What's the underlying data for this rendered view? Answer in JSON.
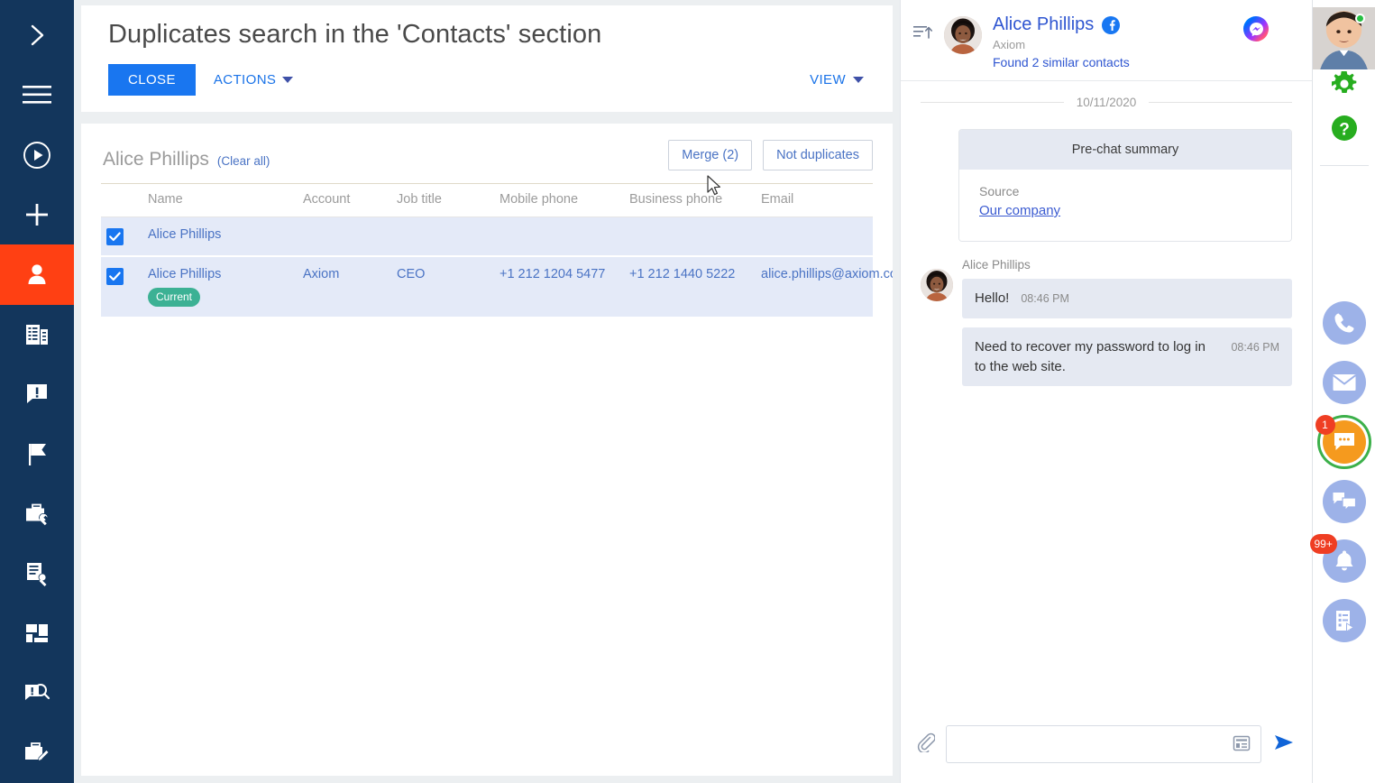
{
  "left_rail": {
    "items": [
      {
        "name": "expand-arrow-icon",
        "label": "Expand"
      },
      {
        "name": "menu-icon",
        "label": "Menu"
      },
      {
        "name": "play-circle-icon",
        "label": "Run process"
      },
      {
        "name": "plus-icon",
        "label": "Add"
      },
      {
        "name": "contacts-icon",
        "label": "Contacts",
        "active": true
      },
      {
        "name": "accounts-icon",
        "label": "Accounts"
      },
      {
        "name": "cases-icon",
        "label": "Cases"
      },
      {
        "name": "flag-icon",
        "label": "Flags"
      },
      {
        "name": "service-briefcase-icon",
        "label": "Services"
      },
      {
        "name": "document-wrench-icon",
        "label": "Configuration items"
      },
      {
        "name": "dashboard-icon",
        "label": "Dashboards"
      },
      {
        "name": "case-search-icon",
        "label": "Knowledge base"
      },
      {
        "name": "briefcase-edit-icon",
        "label": "Requests"
      }
    ]
  },
  "header": {
    "title": "Duplicates search in the 'Contacts' section",
    "close_label": "CLOSE",
    "actions_label": "ACTIONS",
    "view_label": "VIEW"
  },
  "duplicates": {
    "group_title": "Alice Phillips",
    "clear_all_label": "(Clear all)",
    "merge_label": "Merge (2)",
    "not_duplicates_label": "Not duplicates",
    "columns": [
      "",
      "Name",
      "Account",
      "Job title",
      "Mobile phone",
      "Business phone",
      "Email"
    ],
    "rows": [
      {
        "checked": true,
        "name": "Alice Phillips",
        "badge": "",
        "account": "",
        "job_title": "",
        "mobile_phone": "",
        "business_phone": "",
        "email": ""
      },
      {
        "checked": true,
        "name": "Alice Phillips",
        "badge": "Current",
        "account": "Axiom",
        "job_title": "CEO",
        "mobile_phone": "+1 212 1204 5477",
        "business_phone": "+1 212 1440 5222",
        "email": "alice.phillips@axiom.com"
      }
    ]
  },
  "chat": {
    "contact_name": "Alice Phillips",
    "company": "Axiom",
    "similar_contacts": "Found 2 similar contacts",
    "channel_icon": "messenger-icon",
    "social_icon": "facebook-icon",
    "date_separator": "10/11/2020",
    "prechat": {
      "title": "Pre-chat summary",
      "source_label": "Source",
      "source_value": "Our company"
    },
    "messages": [
      {
        "sender": "Alice Phillips",
        "text": "Hello!",
        "time": "08:46 PM",
        "layout": "inline"
      },
      {
        "sender": "",
        "text": "Need to recover my password to log in to the web site.",
        "time": "08:46 PM",
        "layout": "block"
      }
    ],
    "input_value": "",
    "input_placeholder": ""
  },
  "right_rail": {
    "top_icons": [
      {
        "name": "user-avatar",
        "label": "User profile"
      },
      {
        "name": "gear-icon",
        "label": "Settings"
      },
      {
        "name": "help-icon",
        "label": "Help"
      }
    ],
    "comm_icons": [
      {
        "name": "phone-icon",
        "label": "Calls",
        "badge": ""
      },
      {
        "name": "email-icon",
        "label": "Email",
        "badge": ""
      },
      {
        "name": "chat-icon",
        "label": "Chats",
        "badge": "1"
      },
      {
        "name": "chats-list-icon",
        "label": "Chat list",
        "badge": ""
      },
      {
        "name": "bell-icon",
        "label": "Notifications",
        "badge": "99+"
      },
      {
        "name": "feed-icon",
        "label": "Feed",
        "badge": ""
      }
    ]
  },
  "colors": {
    "sidebar_bg": "#13365c",
    "active_item": "#ff4013",
    "primary_button": "#1976f0",
    "link": "#4a73c4",
    "badge_current": "#3cb194",
    "notification_red": "#ef3e23",
    "row_highlight": "#e4eaf8"
  }
}
